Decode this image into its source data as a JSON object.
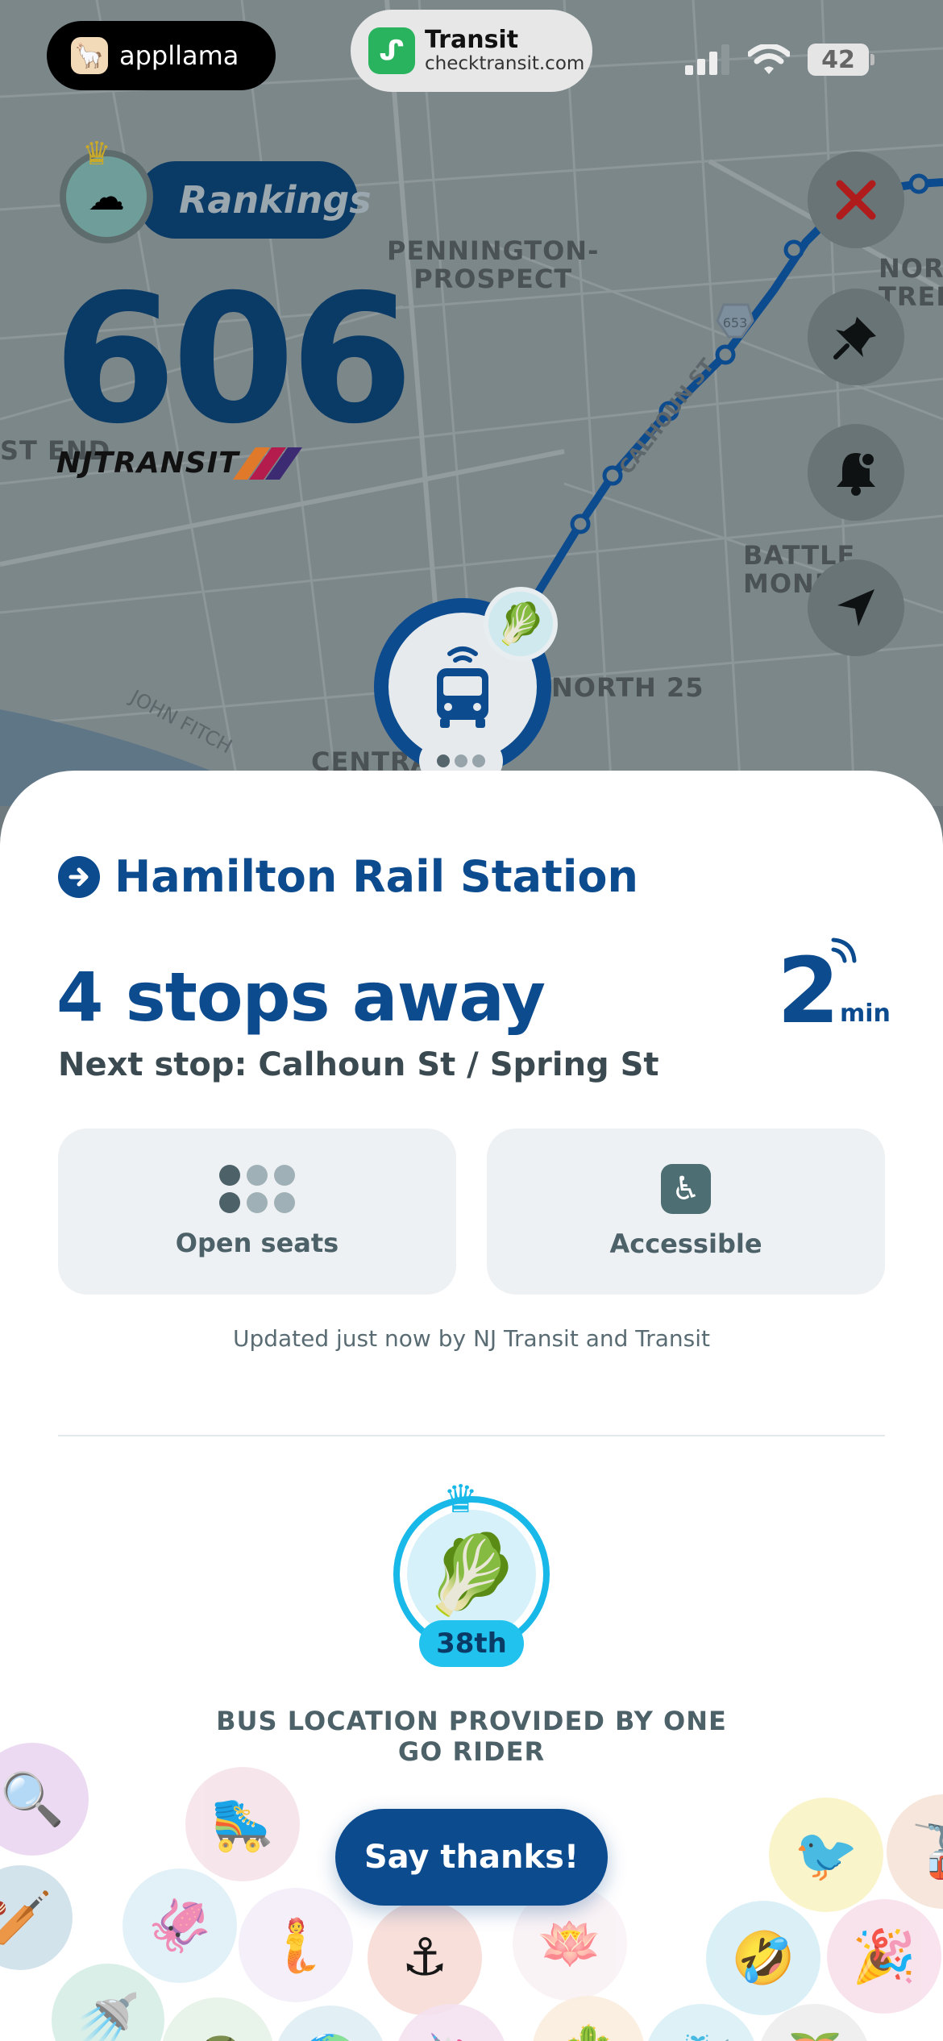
{
  "status_bar": {
    "app_pill": {
      "name": "appllama"
    },
    "transit_pill": {
      "title": "Transit",
      "subtitle": "checktransit.com"
    },
    "battery": "42"
  },
  "map": {
    "labels": [
      "PENNINGTON-\nPROSPECT",
      "NORT\nTRENT",
      "BATTLE\nMONU",
      "NORTH 25",
      "ST END",
      "JOHN FITCH",
      "CENTRA",
      "CALHOUN ST",
      "653"
    ]
  },
  "header": {
    "rankings_label": "Rankings",
    "route_number": "606",
    "agency_name": "TRANSIT",
    "agency_prefix": "NJ"
  },
  "side_buttons": [
    {
      "name": "close",
      "icon": "close-icon"
    },
    {
      "name": "pin",
      "icon": "pin-icon"
    },
    {
      "name": "alert",
      "icon": "bell-icon"
    },
    {
      "name": "location",
      "icon": "navigation-arrow-icon"
    }
  ],
  "trip": {
    "destination": "Hamilton Rail Station",
    "stops_away": "4 stops away",
    "eta_value": "2",
    "eta_unit": "min",
    "next_stop": "Next stop: Calhoun St / Spring St"
  },
  "cards": {
    "seats_label": "Open seats",
    "accessible_label": "Accessible"
  },
  "updated_text": "Updated just now by NJ Transit and Transit",
  "rider": {
    "rank": "38th",
    "provided_text": "BUS LOCATION PROVIDED BY ONE GO RIDER",
    "thanks_label": "Say thanks!"
  },
  "colors": {
    "brand_blue": "#0d4b8f",
    "accent_cyan": "#18b8e8",
    "close_red": "#b01c1c"
  }
}
